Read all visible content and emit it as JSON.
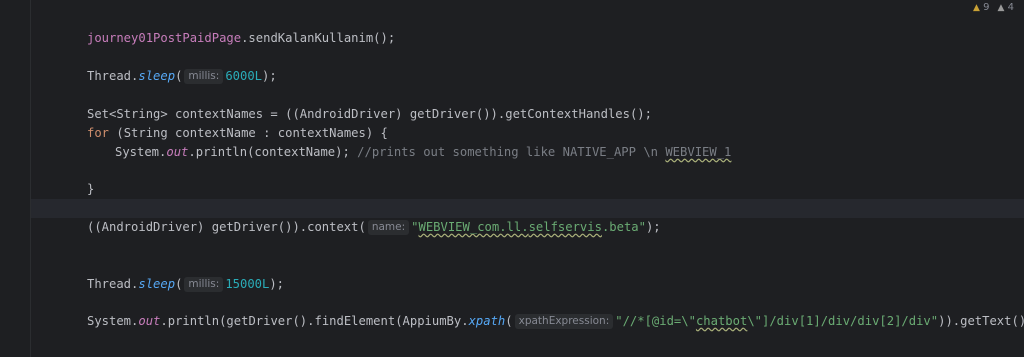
{
  "inspections": {
    "warnings": "9",
    "weak_warnings": "4"
  },
  "colors": {
    "background": "#1e1f22",
    "current_line": "#26282e",
    "keyword": "#cf8e6d",
    "string": "#6aab73",
    "number": "#2aacb8",
    "comment": "#7a7e85",
    "field": "#c77dbb"
  },
  "code": {
    "l1": {
      "obj": "journey01PostPaidPage",
      "rest": ".sendKalanKullanim();"
    },
    "l2": {
      "cls": "Thread.",
      "method": "sleep",
      "open": "(",
      "hint": "millis:",
      "num": "6000L",
      "close": ");"
    },
    "l3": {
      "a": "Set<String> contextNames = ((AndroidDriver) getDriver()).getContextHandles();"
    },
    "l4": {
      "kw": "for",
      "rest": " (String contextName : contextNames) {"
    },
    "l5": {
      "a": "System.",
      "out": "out",
      "b": ".println(contextName); ",
      "comment": "//prints out something like NATIVE_APP \\n ",
      "comment2": "WEBVIEW_1"
    },
    "l6": {
      "a": "}"
    },
    "l7": {
      "a": "((AndroidDriver) getDriver()).context(",
      "hint": "name:",
      "str_open": "\"",
      "s1": "WEBVIEW_com.ll.",
      "s2": "selfservis",
      "s3": ".beta\"",
      "close": ");"
    },
    "l8": {
      "cls": "Thread.",
      "method": "sleep",
      "open": "(",
      "hint": "millis:",
      "num": "15000L",
      "close": ");"
    },
    "l9": {
      "a": "System.",
      "out": "out",
      "b": ".println(getDriver().findElement(AppiumBy.",
      "xpath": "xpath",
      "open": "(",
      "hint": "xpathExpression:",
      "s1": "\"//*[@id=\\\"",
      "s2": "chatbot",
      "s3": "\\\"]/div[1]/div/div[2]/div\"",
      "close": ")).getText());"
    }
  },
  "icons": {
    "bulb": "lightbulb-icon",
    "warning": "warning-triangle-icon"
  }
}
